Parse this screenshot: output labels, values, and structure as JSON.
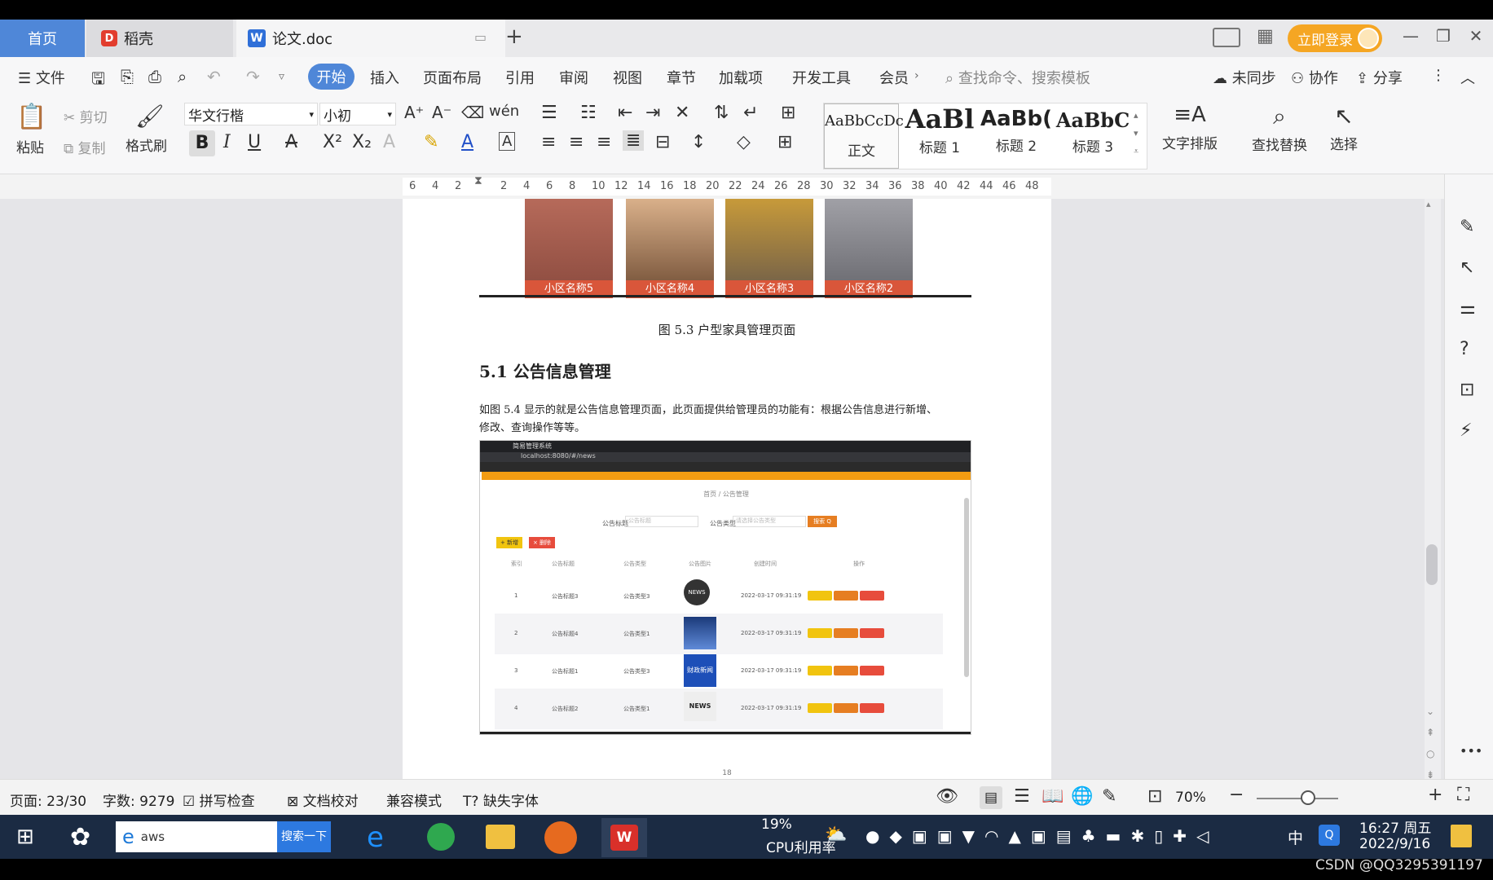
{
  "tabs": {
    "home": "首页",
    "docer": "稻壳",
    "doc": "论文.doc",
    "new_tab": "+",
    "login": "立即登录"
  },
  "menu": {
    "file": "文件",
    "items": [
      "开始",
      "插入",
      "页面布局",
      "引用",
      "审阅",
      "视图",
      "章节",
      "加载项",
      "开发工具",
      "会员"
    ],
    "search_placeholder": "查找命令、搜索模板",
    "sync": "未同步",
    "collab": "协作",
    "share": "分享"
  },
  "ribbon": {
    "paste": "粘贴",
    "cut": "剪切",
    "copy": "复制",
    "format_painter": "格式刷",
    "font": "华文行楷",
    "size": "小初",
    "styles": [
      {
        "preview": "AaBbCcDc",
        "label": "正文"
      },
      {
        "preview": "AaBl",
        "label": "标题 1"
      },
      {
        "preview": "AaBb(",
        "label": "标题 2"
      },
      {
        "preview": "AaBbC",
        "label": "标题 3"
      }
    ],
    "text_layout": "文字排版",
    "find_replace": "查找替换",
    "select": "选择"
  },
  "ruler": {
    "ticks": [
      "6",
      "4",
      "2",
      "",
      "2",
      "4",
      "6",
      "8",
      "10",
      "12",
      "14",
      "16",
      "18",
      "20",
      "22",
      "24",
      "26",
      "28",
      "30",
      "32",
      "34",
      "36",
      "38",
      "40",
      "42",
      "44",
      "46",
      "48"
    ]
  },
  "document": {
    "photo_captions": [
      "小区名称5",
      "小区名称4",
      "小区名称3",
      "小区名称2"
    ],
    "figure_caption": "图 5.3  户型家具管理页面",
    "heading": "5.1 公告信息管理",
    "body_line1": "如图 5.4 显示的就是公告信息管理页面，此页面提供给管理员的功能有：根据公告信息进行新增、",
    "body_line2": "修改、查询操作等等。",
    "page_number": "18",
    "screenshot": {
      "browser_tab": "简易管理系统",
      "url": "localhost:8080/#/news",
      "breadcrumb": "首页 / 公告管理",
      "filter1_label": "公告标题",
      "filter1_placeholder": "公告标题",
      "filter2_label": "公告类型",
      "filter2_placeholder": "请选择公告类型",
      "search_btn": "搜索 Q",
      "add_btn": "+ 新增",
      "del_btn": "× 删除",
      "columns": [
        "索引",
        "公告标题",
        "公告类型",
        "公告图片",
        "创建时间",
        "操作"
      ],
      "rows": [
        {
          "index": "1",
          "title": "公告标题3",
          "type": "公告类型3",
          "time": "2022-03-17 09:31:19",
          "img": "NEWS"
        },
        {
          "index": "2",
          "title": "公告标题4",
          "type": "公告类型1",
          "time": "2022-03-17 09:31:19",
          "img": ""
        },
        {
          "index": "3",
          "title": "公告标题1",
          "type": "公告类型3",
          "time": "2022-03-17 09:31:19",
          "img": "财政新闻"
        },
        {
          "index": "4",
          "title": "公告标题2",
          "type": "公告类型1",
          "time": "2022-03-17 09:31:19",
          "img": "NEWS"
        }
      ],
      "row_actions": [
        "详情",
        "修改",
        "删除"
      ]
    }
  },
  "status": {
    "page": "页面: 23/30",
    "words": "字数: 9279",
    "spell": "拼写检查",
    "proof": "文档校对",
    "compat": "兼容模式",
    "missing_font": "缺失字体",
    "zoom": "70%"
  },
  "taskbar": {
    "search_value": "aws",
    "search_btn": "搜索一下",
    "cpu_pct": "19%",
    "cpu_label": "CPU利用率",
    "ime": "中",
    "time": "16:27 周五",
    "date": "2022/9/16"
  },
  "watermark": "CSDN @QQ3295391197",
  "colors": {
    "accent": "#4f87d8",
    "login": "#f5a623",
    "taskbar": "#1b2b43",
    "orange_bar": "#f39c12"
  }
}
